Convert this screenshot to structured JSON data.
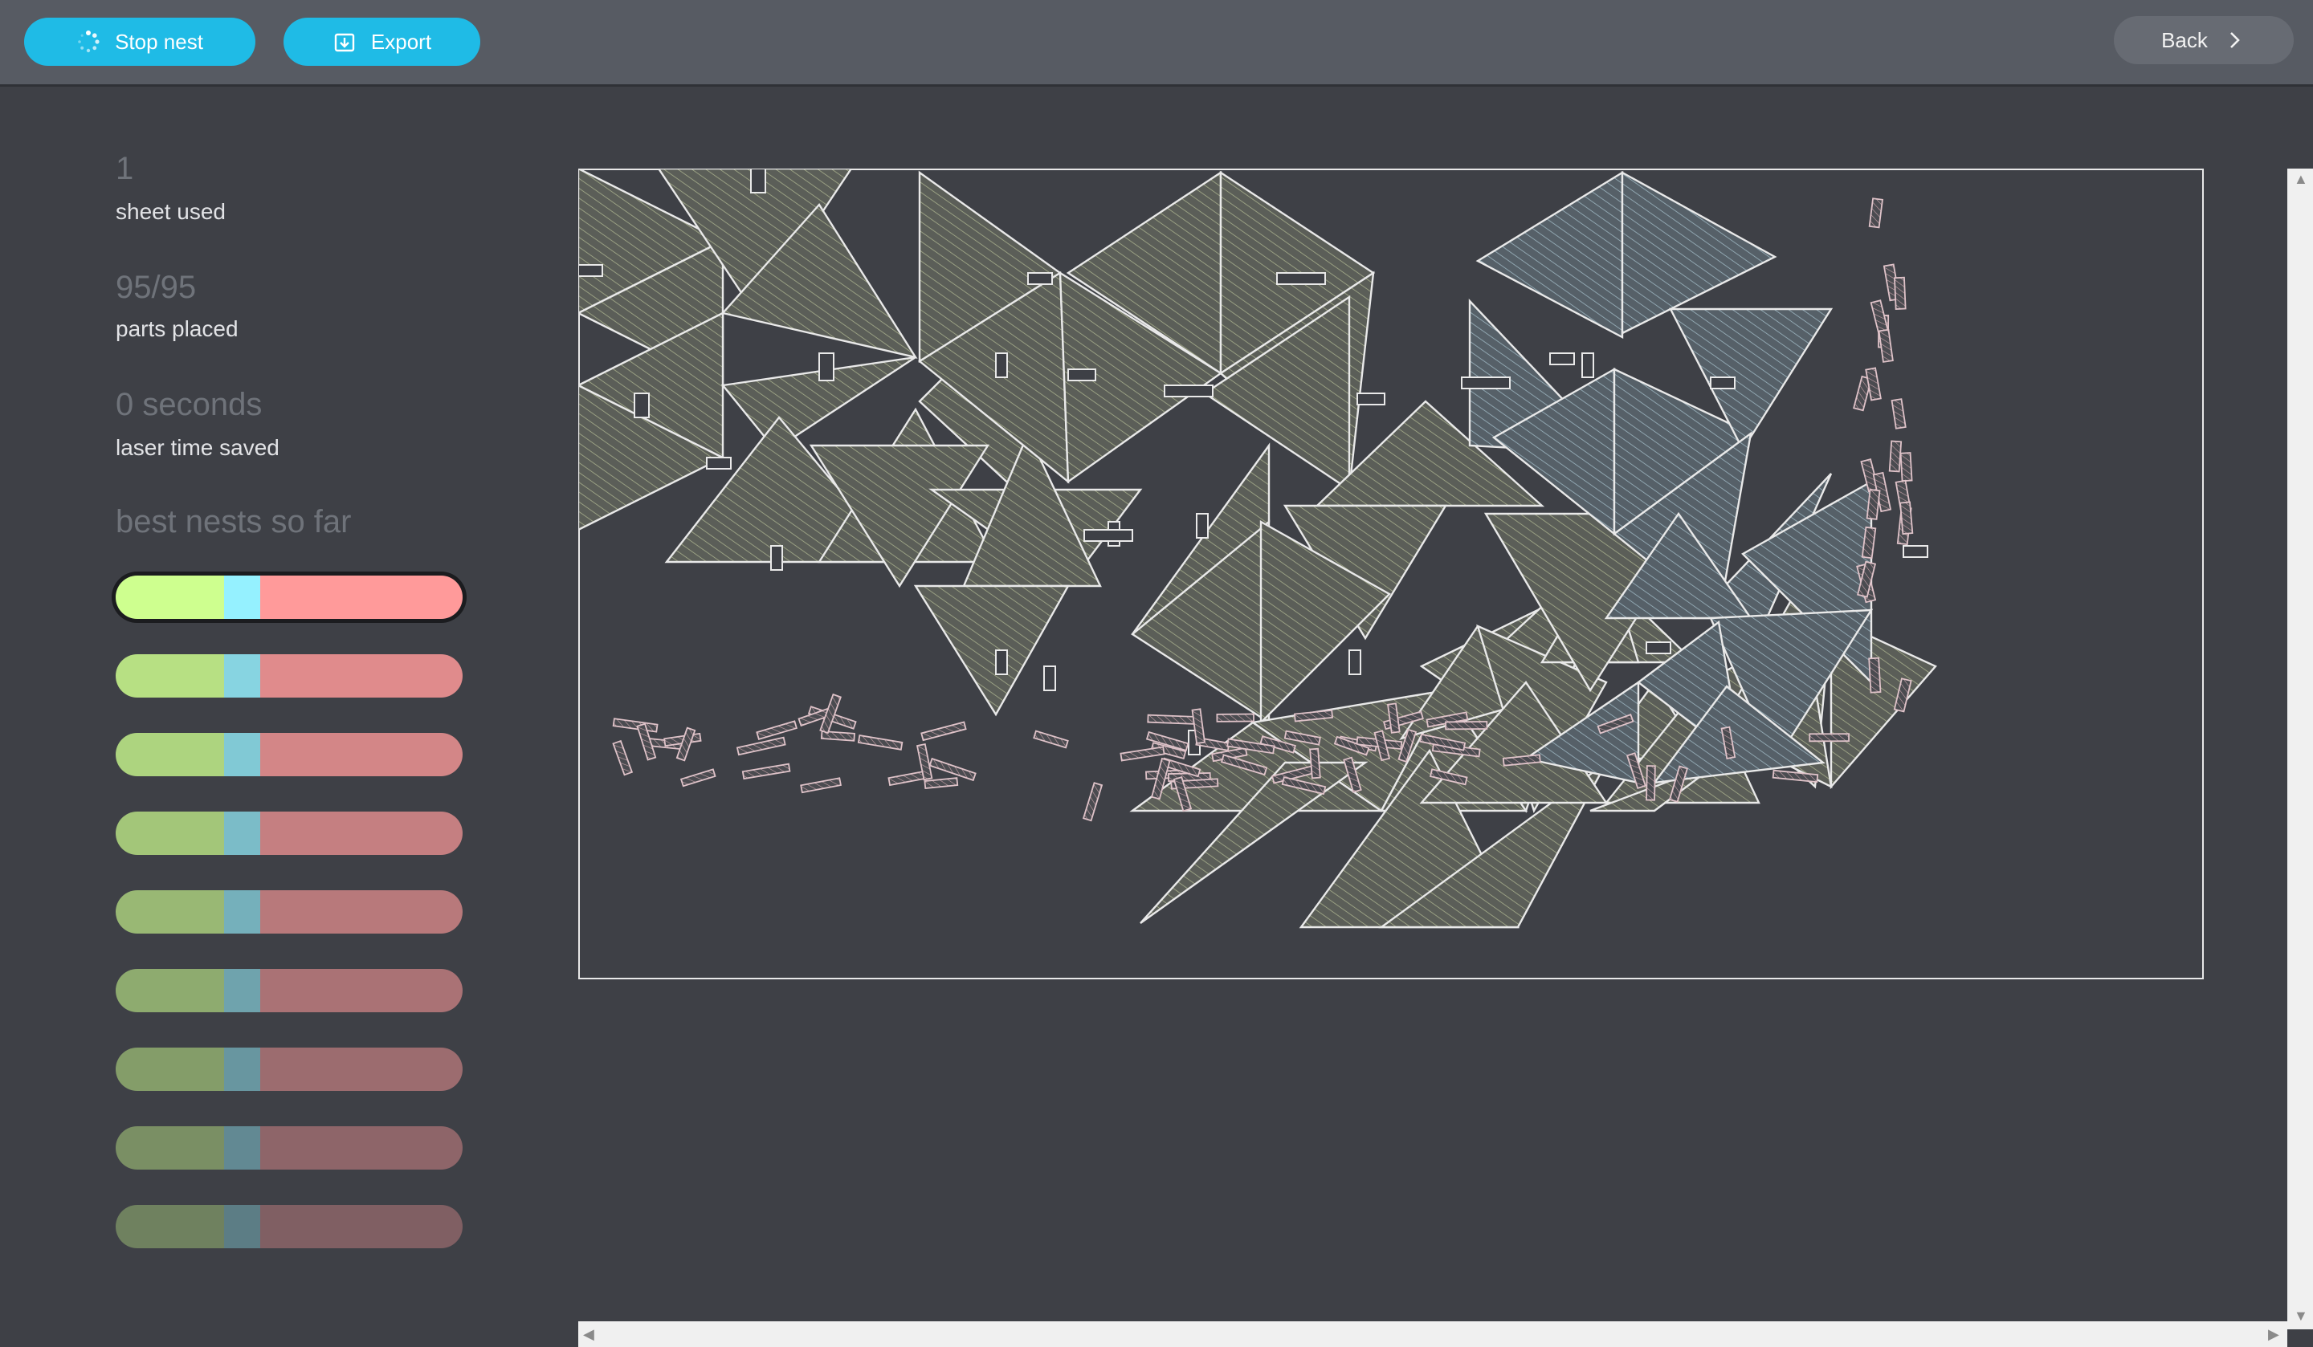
{
  "toolbar": {
    "stop_label": "Stop nest",
    "export_label": "Export",
    "back_label": "Back"
  },
  "icons": {
    "stop": "spinner-icon",
    "export": "export-icon",
    "back": "chevron-right-icon"
  },
  "stats": {
    "sheets_value": "1",
    "sheets_label": "sheet used",
    "parts_value": "95/95",
    "parts_label": "parts placed",
    "time_value": "0 seconds",
    "time_label": "laser time saved"
  },
  "best_nests": {
    "title": "best nests so far",
    "count": 9,
    "selected_index": 0
  },
  "colors": {
    "primary": "#1fbbe6",
    "part_fill": "#5b5e58",
    "part_stroke": "#e9e9e9",
    "hatch": "#a7ae8c",
    "tab_stroke": "#d9b3bb",
    "blue_part_fill": "#566068"
  }
}
